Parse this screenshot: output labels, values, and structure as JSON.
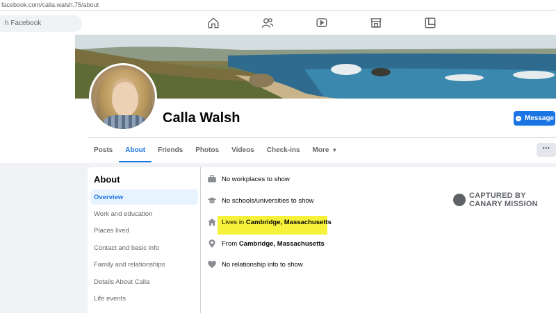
{
  "browser": {
    "url": "facebook.com/calla.walsh.75/about"
  },
  "topnav": {
    "search_placeholder": "h Facebook",
    "icons": [
      "home-icon",
      "friends-icon",
      "watch-icon",
      "marketplace-icon",
      "gaming-icon"
    ]
  },
  "profile": {
    "name": "Calla Walsh",
    "message_label": "Message",
    "more_menu_label": "···"
  },
  "tabs": [
    {
      "label": "Posts"
    },
    {
      "label": "About",
      "active": true
    },
    {
      "label": "Friends"
    },
    {
      "label": "Photos"
    },
    {
      "label": "Videos"
    },
    {
      "label": "Check-ins"
    },
    {
      "label": "More"
    }
  ],
  "about": {
    "heading": "About",
    "sections": [
      {
        "label": "Overview",
        "active": true
      },
      {
        "label": "Work and education"
      },
      {
        "label": "Places lived"
      },
      {
        "label": "Contact and basic info"
      },
      {
        "label": "Family and relationships"
      },
      {
        "label": "Details About Calla"
      },
      {
        "label": "Life events"
      }
    ],
    "overview": {
      "work": "No workplaces to show",
      "school": "No schools/universities to show",
      "lives_prefix": "Lives in ",
      "lives_place": "Cambridge, Massachusetts",
      "from_prefix": "From ",
      "from_place": "Cambridge, Massachusetts",
      "relationship": "No relationship info to show"
    }
  },
  "watermark": {
    "line1": "CAPTURED BY",
    "line2": "CANARY MISSION"
  },
  "colors": {
    "accent": "#1b74e4",
    "highlight": "#f6f13a",
    "background": "#f0f2f5"
  }
}
